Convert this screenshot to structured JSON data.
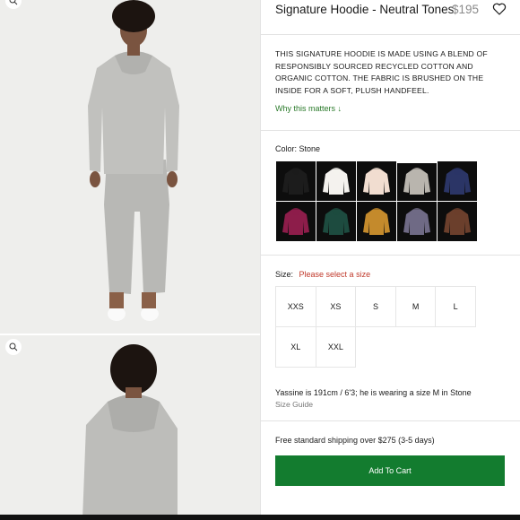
{
  "product": {
    "title": "Signature Hoodie - Neutral Tones",
    "price": "$195",
    "description": "THIS SIGNATURE HOODIE IS MADE USING A BLEND OF RESPONSIBLY SOURCED RECYCLED COTTON AND ORGANIC COTTON. THE FABRIC IS BRUSHED ON THE INSIDE FOR A SOFT, PLUSH HANDFEEL.",
    "why_link": "Why this matters ↓"
  },
  "colors": {
    "label": "Color: Stone",
    "swatches": [
      {
        "hex": "#1c1c1c"
      },
      {
        "hex": "#f4f2ee"
      },
      {
        "hex": "#f1ddd0"
      },
      {
        "hex": "#b9b5ae"
      },
      {
        "hex": "#2b3566"
      },
      {
        "hex": "#8d1d4a"
      },
      {
        "hex": "#1d4b3f"
      },
      {
        "hex": "#c48a2c"
      },
      {
        "hex": "#6f6a85"
      },
      {
        "hex": "#6b3f2c"
      }
    ],
    "selected_index": 3
  },
  "sizes": {
    "label": "Size:",
    "warning": "Please select a size",
    "options": [
      "XXS",
      "XS",
      "S",
      "M",
      "L",
      "XL",
      "XXL"
    ]
  },
  "model_note": "Yassine is 191cm / 6'3; he is wearing a size M in Stone",
  "size_guide": "Size Guide",
  "shipping": "Free standard shipping over $275 (3-5 days)",
  "cart_button": "Add To Cart",
  "theme": {
    "accent": "#137c2f",
    "warning": "#c0392b",
    "link": "#2a7a2a"
  }
}
